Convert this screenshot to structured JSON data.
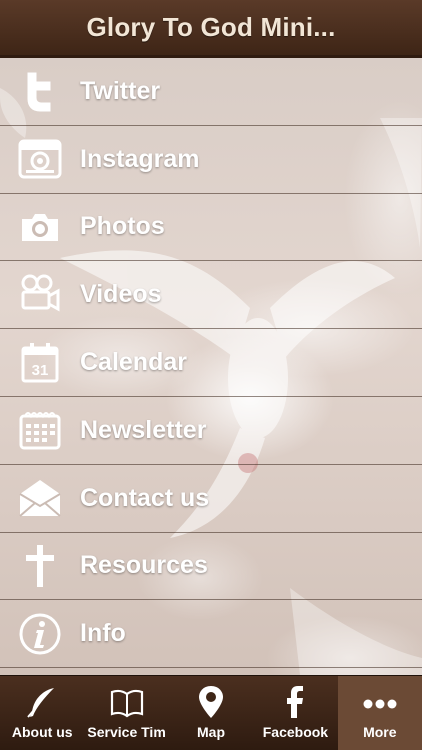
{
  "header": {
    "title": "Glory To God Mini..."
  },
  "menu": {
    "items": [
      {
        "label": "Twitter",
        "icon": "twitter-icon"
      },
      {
        "label": "Instagram",
        "icon": "instagram-icon"
      },
      {
        "label": "Photos",
        "icon": "camera-icon"
      },
      {
        "label": "Videos",
        "icon": "video-camera-icon"
      },
      {
        "label": "Calendar",
        "icon": "calendar-icon",
        "icon_text": "31"
      },
      {
        "label": "Newsletter",
        "icon": "newsletter-icon"
      },
      {
        "label": "Contact us",
        "icon": "envelope-icon"
      },
      {
        "label": "Resources",
        "icon": "cross-icon"
      },
      {
        "label": "Info",
        "icon": "info-icon"
      }
    ]
  },
  "tabbar": {
    "active_index": 4,
    "items": [
      {
        "label": "About us",
        "icon": "quill-icon"
      },
      {
        "label": "Service Tim",
        "icon": "book-icon"
      },
      {
        "label": "Map",
        "icon": "map-pin-icon"
      },
      {
        "label": "Facebook",
        "icon": "facebook-icon"
      },
      {
        "label": "More",
        "icon": "more-dots-icon"
      }
    ]
  },
  "colors": {
    "header_bg": "#4a2e1e",
    "header_text": "#f2e6d6",
    "tabbar_bg": "#3b2415",
    "tab_active_bg": "#6b4a35",
    "menu_text": "#ffffff"
  }
}
